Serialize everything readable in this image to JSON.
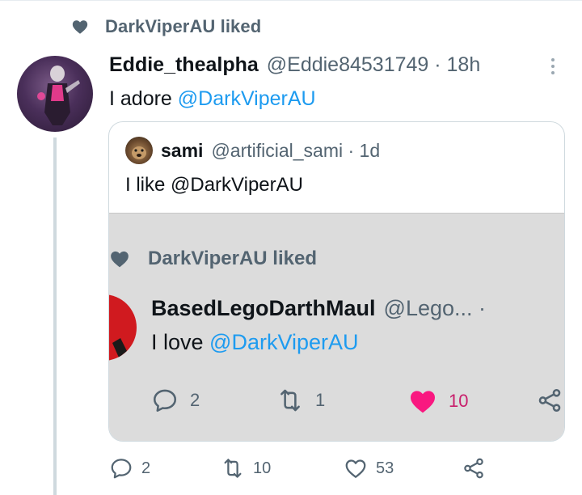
{
  "social_context": {
    "text": "DarkViperAU liked",
    "icon": "heart-icon"
  },
  "tweet": {
    "display_name": "Eddie_thealpha",
    "handle_time": "@Eddie84531749 · 18h",
    "text_prefix": "I adore ",
    "mention": "@DarkViperAU",
    "actions": {
      "replies": "2",
      "retweets": "10",
      "likes": "53"
    }
  },
  "quote": {
    "display_name": "sami",
    "handle_time": "@artificial_sami · 1d",
    "text": "I like @DarkViperAU",
    "embedded": {
      "context": "DarkViperAU liked",
      "display_name": "BasedLegoDarthMaul",
      "handle": "@Lego... ·",
      "text_prefix": "I love ",
      "mention": "@DarkViperAU",
      "actions": {
        "replies": "2",
        "retweets": "1",
        "likes": "10"
      }
    }
  },
  "colors": {
    "accent": "#1d9bf0",
    "muted": "#536471",
    "like_pink": "#f91880"
  }
}
